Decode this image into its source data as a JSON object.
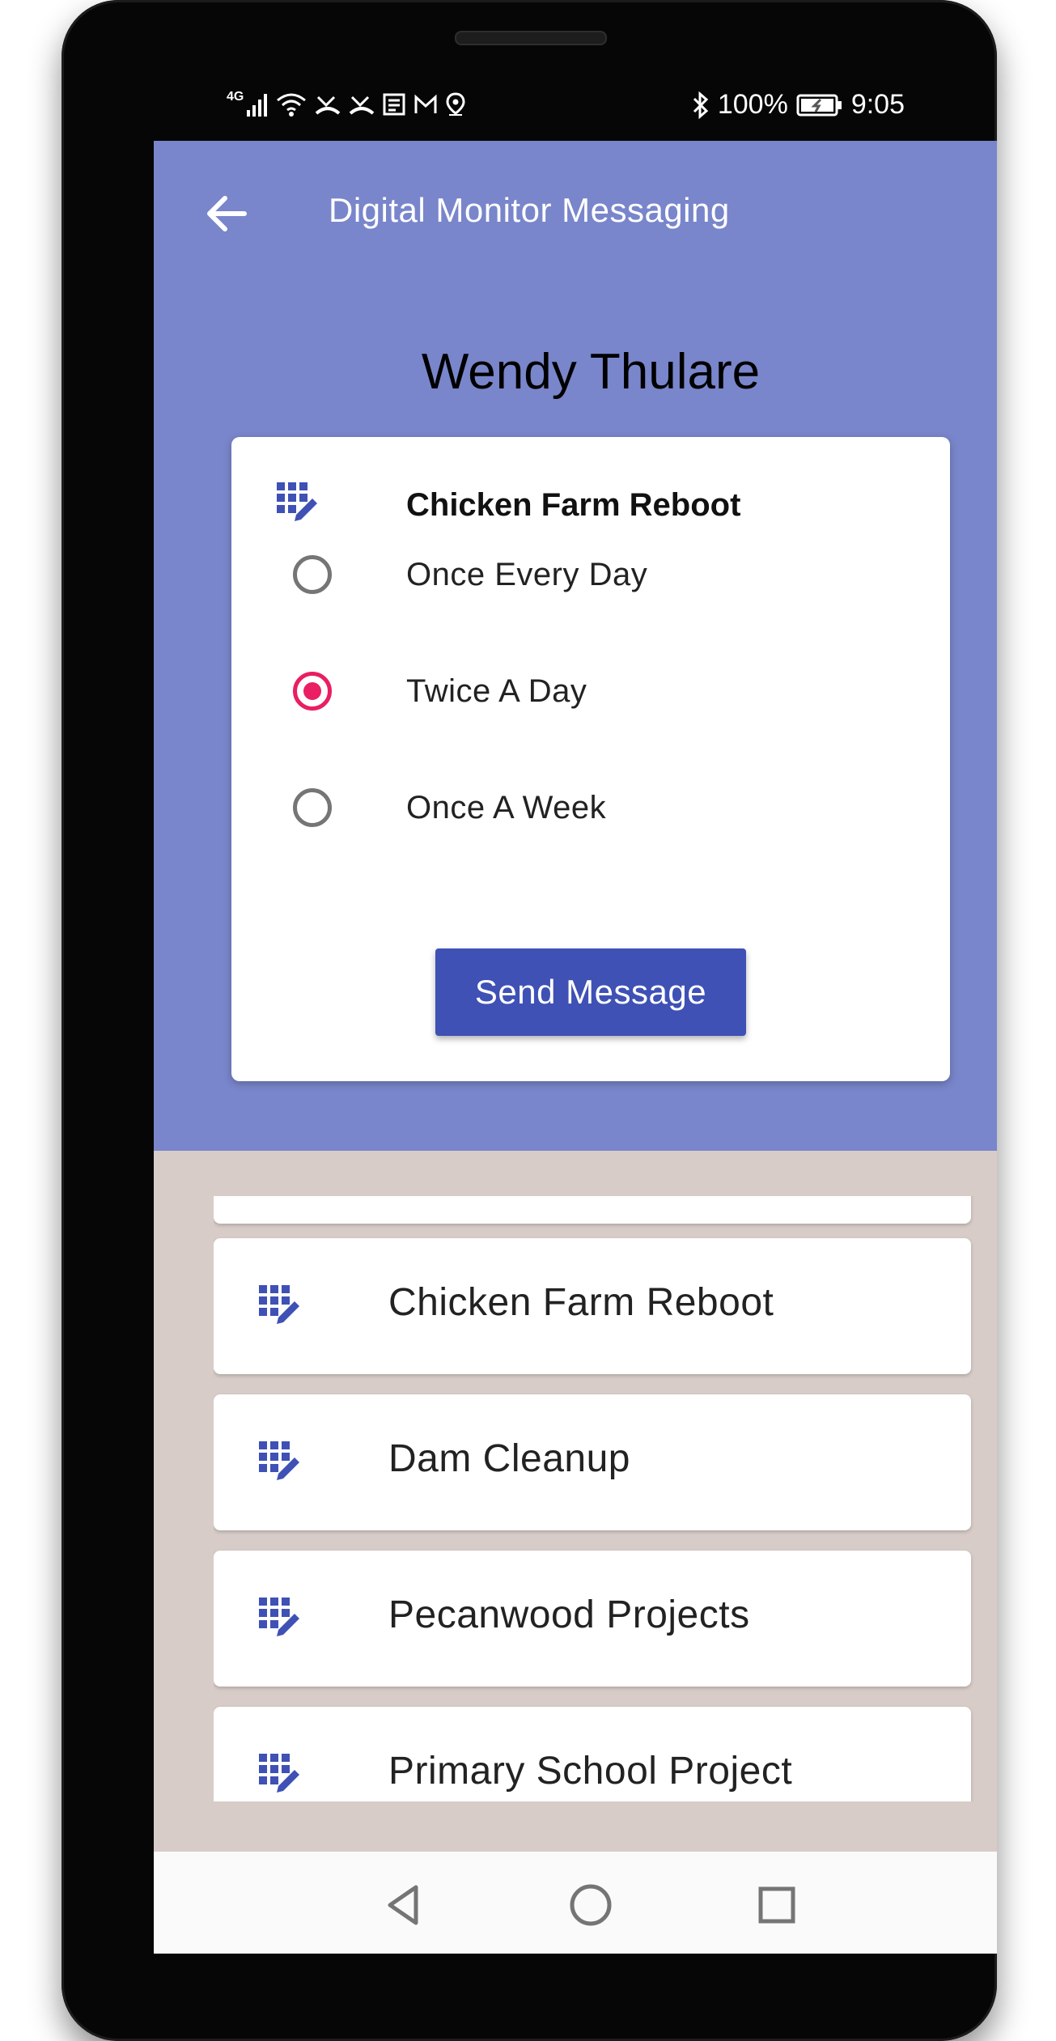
{
  "status_bar": {
    "network": "4G",
    "battery": "100%",
    "time": "9:05",
    "icons": [
      "signal-icon",
      "wifi-icon",
      "missed-call-icon",
      "missed-call-icon",
      "news-icon",
      "gmail-icon",
      "location-icon",
      "bluetooth-icon",
      "battery-charging-icon"
    ]
  },
  "app_bar": {
    "title": "Digital Monitor Messaging",
    "back_icon": "arrow-back-icon"
  },
  "person": {
    "name": "Wendy Thulare"
  },
  "card": {
    "project_icon": "grid-edit-icon",
    "project_title": "Chicken Farm Reboot",
    "options": [
      {
        "label": "Once Every Day",
        "selected": false
      },
      {
        "label": "Twice A Day",
        "selected": true
      },
      {
        "label": "Once A Week",
        "selected": false
      }
    ],
    "send_button": "Send Message"
  },
  "project_list": {
    "items": [
      {
        "label": "Chicken Farm Reboot",
        "icon": "grid-edit-icon"
      },
      {
        "label": "Dam Cleanup",
        "icon": "grid-edit-icon"
      },
      {
        "label": "Pecanwood Projects",
        "icon": "grid-edit-icon"
      },
      {
        "label": "Primary School Project",
        "icon": "grid-edit-icon"
      }
    ]
  },
  "colors": {
    "header_bg": "#7986cb",
    "primary": "#3f51b5",
    "accent": "#e91e63",
    "list_bg": "#d7ccc8"
  },
  "nav_bar": {
    "buttons": [
      "back-triangle-icon",
      "home-circle-icon",
      "recents-square-icon"
    ]
  }
}
